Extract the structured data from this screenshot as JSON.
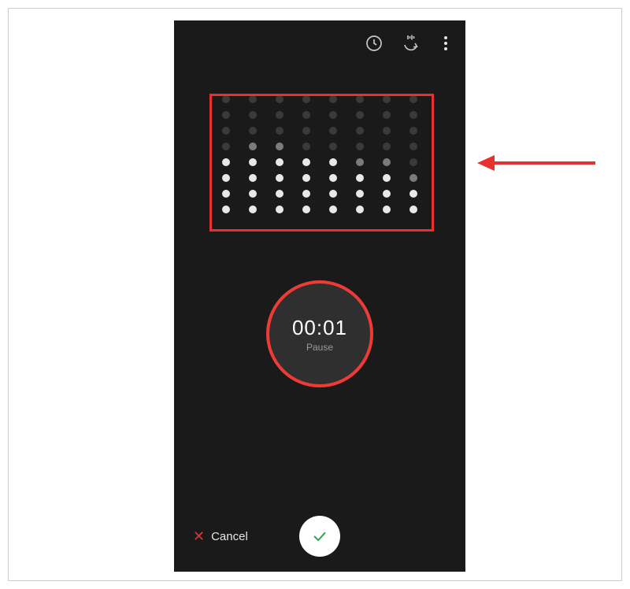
{
  "toolbar": {
    "history_icon": "history-icon",
    "convert_icon": "convert-icon",
    "menu_icon": "more-menu-icon"
  },
  "visualizer": {
    "columns": [
      {
        "levels": [
          "dim",
          "dim",
          "dim",
          "dim",
          "bright",
          "bright",
          "bright",
          "bright"
        ]
      },
      {
        "levels": [
          "dim",
          "dim",
          "dim",
          "mid",
          "bright",
          "bright",
          "bright",
          "bright"
        ]
      },
      {
        "levels": [
          "dim",
          "dim",
          "dim",
          "mid",
          "bright",
          "bright",
          "bright",
          "bright"
        ]
      },
      {
        "levels": [
          "dim",
          "dim",
          "dim",
          "dim",
          "bright",
          "bright",
          "bright",
          "bright"
        ]
      },
      {
        "levels": [
          "dim",
          "dim",
          "dim",
          "dim",
          "bright",
          "bright",
          "bright",
          "bright"
        ]
      },
      {
        "levels": [
          "dim",
          "dim",
          "dim",
          "dim",
          "mid",
          "bright",
          "bright",
          "bright"
        ]
      },
      {
        "levels": [
          "dim",
          "dim",
          "dim",
          "dim",
          "mid",
          "bright",
          "bright",
          "bright"
        ]
      },
      {
        "levels": [
          "dim",
          "dim",
          "dim",
          "dim",
          "dim",
          "mid",
          "bright",
          "bright"
        ]
      }
    ]
  },
  "recorder": {
    "time": "00:01",
    "state_label": "Pause"
  },
  "bottom": {
    "cancel_label": "Cancel"
  },
  "colors": {
    "accent_red": "#ef3b36",
    "annotation_red": "#e8312e",
    "confirm_green": "#3aa757",
    "bg_dark": "#1a1a1a"
  }
}
